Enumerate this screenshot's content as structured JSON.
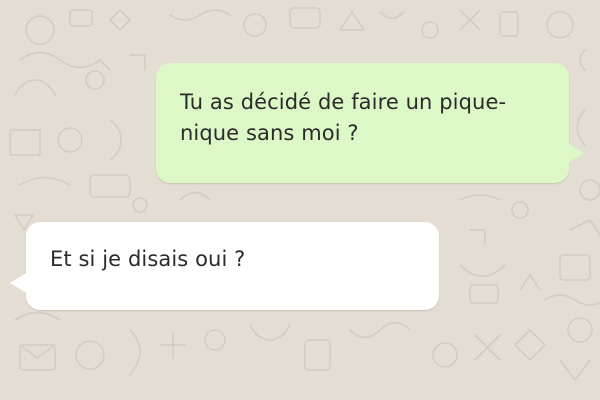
{
  "chat": {
    "background_color": "#e4ddd3",
    "background_pattern": "doodle-icons-pattern",
    "messages": [
      {
        "direction": "outgoing",
        "text": "Tu as décidé de faire un pique-nique sans moi ?",
        "bubble_color": "#dcf8c6"
      },
      {
        "direction": "incoming",
        "text": "Et si je disais oui ?",
        "bubble_color": "#ffffff"
      }
    ]
  }
}
